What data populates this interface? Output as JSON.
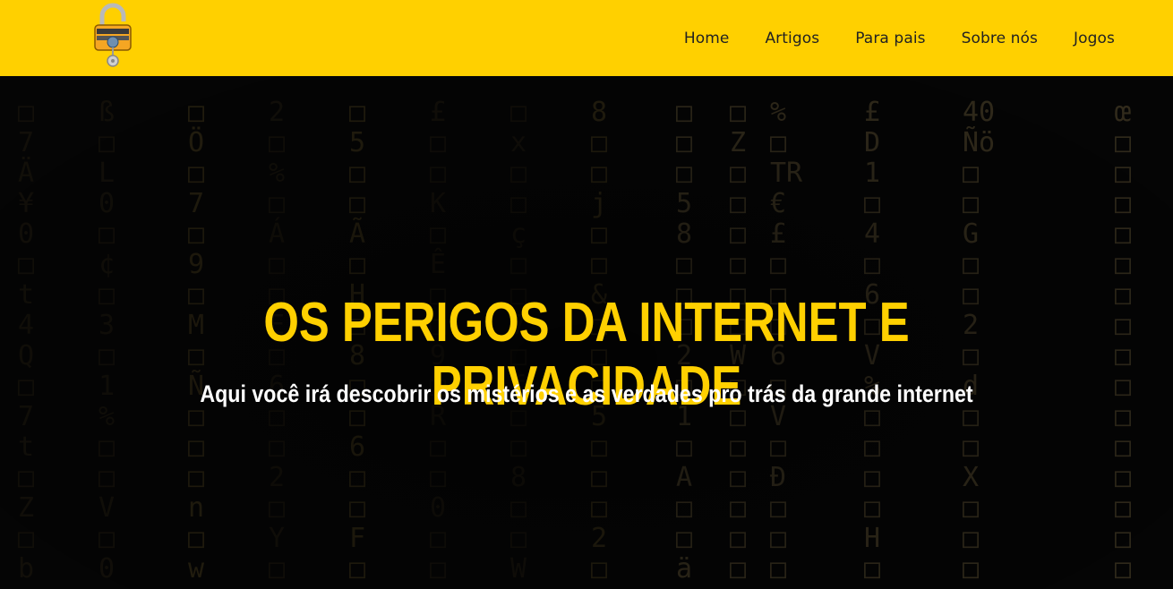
{
  "header": {
    "logo_icon": "padlock-logo-icon",
    "accent_color": "#FFD000",
    "nav": [
      {
        "label": "Home"
      },
      {
        "label": "Artigos"
      },
      {
        "label": "Para pais"
      },
      {
        "label": "Sobre nós"
      },
      {
        "label": "Jogos"
      }
    ]
  },
  "hero": {
    "title": "OS PERIGOS DA INTERNET E PRIVACIDADE",
    "subtitle": "Aqui você irá descobrir os mistérios e as verdades pro trás da grande internet",
    "background": "matrix-code-background"
  }
}
